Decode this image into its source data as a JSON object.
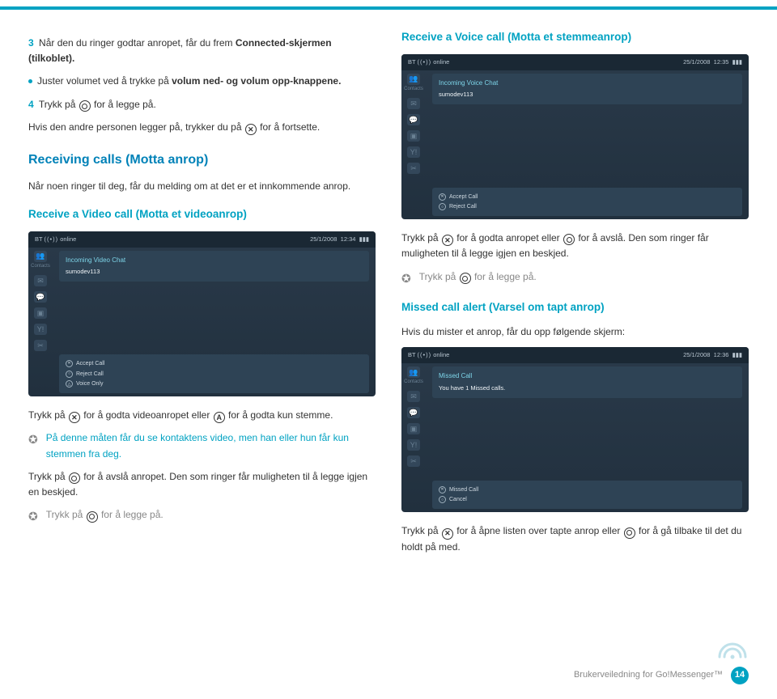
{
  "left": {
    "step3": {
      "num": "3",
      "pre": "Når den du ringer godtar anropet, får du frem ",
      "bold": "Connected-skjermen (tilkoblet).",
      "post": ""
    },
    "bullet": {
      "pre": "Juster volumet ved å trykke på ",
      "bold": "volum ned- og volum opp-knappene."
    },
    "step4": {
      "num": "4",
      "pre": "Trykk på ",
      "post": " for å legge på."
    },
    "continue": {
      "pre": "Hvis den andre personen legger på, trykker du på ",
      "post": " for å fortsette."
    },
    "h_receiving": "Receiving calls (Motta anrop)",
    "receiving_p": "Når noen ringer til deg, får du melding om at det er et innkommende anrop.",
    "h_videocall": "Receive a Video call (Motta et videoanrop)",
    "after1": {
      "pre": "Trykk på ",
      "mid": " for å godta videoanropet eller ",
      "post": " for å godta kun stemme."
    },
    "note1": "På denne måten får du se kontaktens video, men han eller hun får kun stemmen fra deg.",
    "decline": {
      "pre": "Trykk på ",
      "post": " for å avslå anropet. Den som ringer får muligheten til å legge igjen en beskjed."
    },
    "hangup": {
      "pre": "Trykk på ",
      "post": " for å legge på."
    }
  },
  "right": {
    "h_voicecall": "Receive a Voice call (Motta et stemmeanrop)",
    "voice_p": {
      "pre": "Trykk på ",
      "mid": " for å godta anropet eller ",
      "post": " for å avslå. Den som ringer får muligheten til å legge igjen en beskjed."
    },
    "hangup": {
      "pre": "Trykk på ",
      "post": " for å legge på."
    },
    "h_missed": "Missed call alert (Varsel om tapt anrop)",
    "missed_p": "Hvis du mister et anrop, får du opp følgende skjerm:",
    "missed_action": {
      "pre": "Trykk på ",
      "mid": " for å åpne listen over tapte anrop eller ",
      "post": " for å gå tilbake til det du holdt på med."
    }
  },
  "shot_video": {
    "status": "online",
    "date": "25/1/2008",
    "time": "12:34",
    "panel_t": "Incoming Video Chat",
    "panel_s": "sumodev113",
    "b1": "Accept Call",
    "b2": "Reject Call",
    "b3": "Voice Only",
    "side": "Contacts"
  },
  "shot_voice": {
    "status": "online",
    "date": "25/1/2008",
    "time": "12:35",
    "panel_t": "Incoming Voice Chat",
    "panel_s": "sumodev113",
    "b1": "Accept Call",
    "b2": "Reject Call",
    "side": "Contacts"
  },
  "shot_missed": {
    "status": "online",
    "date": "25/1/2008",
    "time": "12:36",
    "panel_t": "Missed Call",
    "panel_s": "You have 1 Missed calls.",
    "b1": "Missed Call",
    "b2": "Cancel",
    "side": "Contacts"
  },
  "footer": {
    "text": "Brukerveiledning for Go!Messenger™",
    "page": "14"
  }
}
